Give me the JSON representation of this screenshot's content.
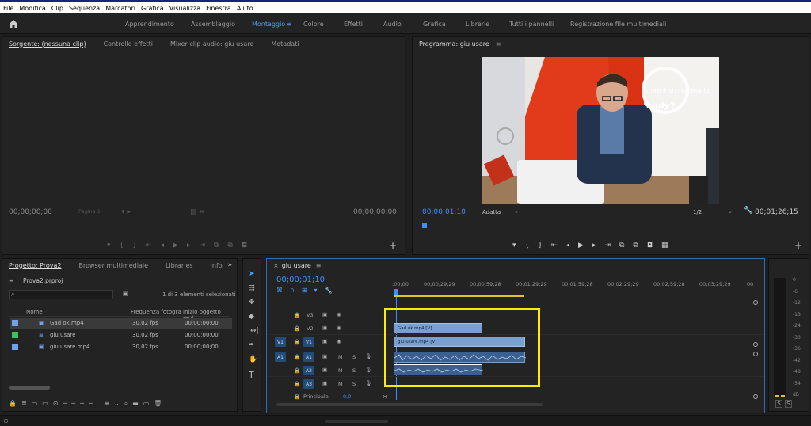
{
  "menu": [
    "File",
    "Modifica",
    "Clip",
    "Sequenza",
    "Marcatori",
    "Grafica",
    "Visualizza",
    "Finestra",
    "Aiuto"
  ],
  "workspaces": [
    "Apprendimento",
    "Assemblaggio",
    "Montaggio",
    "Colore",
    "Effetti",
    "Audio",
    "Grafica",
    "Librerie",
    "Tutti i pannelli",
    "Registrazione file multimediali"
  ],
  "source": {
    "tabs": [
      "Sorgente: (nessuna clip)",
      "Controllo effetti",
      "Mixer clip audio: giu usare",
      "Metadati"
    ],
    "tc_in": "00;00;00;00",
    "tc_out": "00;00;00;00",
    "page": "Pagina 1"
  },
  "program": {
    "title": "Programma: giu usare",
    "tc_current": "00;00;01;10",
    "fit": "Adatta",
    "resolution": "1/2",
    "tc_duration": "00;01;26;15",
    "video_text_1": "uturo è straordinario.",
    "video_text_2": "eady?"
  },
  "project": {
    "tabs": [
      "Progetto: Prova2",
      "Browser multimediale",
      "Libraries",
      "Info"
    ],
    "file": "Prova2.prproj",
    "count": "1 di 3 elementi selezionati",
    "columns": [
      "Nome",
      "Frequenza fotogra",
      "Inizio oggetto mul"
    ],
    "rows": [
      {
        "name": "Gad ok.mp4",
        "fps": "30,02 fps",
        "start": "00;00;00;00",
        "color": "#6fa3e6"
      },
      {
        "name": "giu usare",
        "fps": "30,02 fps",
        "start": "00;00;00;00",
        "color": "#3fbf5a"
      },
      {
        "name": "giu usare.mp4",
        "fps": "30,02 fps",
        "start": "00;00;00;00",
        "color": "#6fa3e6"
      }
    ]
  },
  "timeline": {
    "title": "giu usare",
    "tc": "00;00;01;10",
    "ruler": [
      ":00;00",
      "00;00;29;29",
      "00;00;59;28",
      "00;01;29;29",
      "00;01;59;28",
      "00;02;29;29",
      "00;02;59;28",
      "00;03;29;29",
      "00"
    ],
    "video_tracks": [
      "V3",
      "V2",
      "V1"
    ],
    "audio_tracks": [
      "A1",
      "A2",
      "A3"
    ],
    "clip_v2": "Gad ok.mp4 [V]",
    "clip_v1": "giu usare.mp4 [V]",
    "master": "Principale",
    "master_val": "0,0"
  },
  "meter_labels": [
    "0",
    "-6",
    "-12",
    "-18",
    "-24",
    "-30",
    "-36",
    "-42",
    "-48",
    "-54",
    "dB"
  ],
  "meter_solo": [
    "S",
    "S"
  ]
}
